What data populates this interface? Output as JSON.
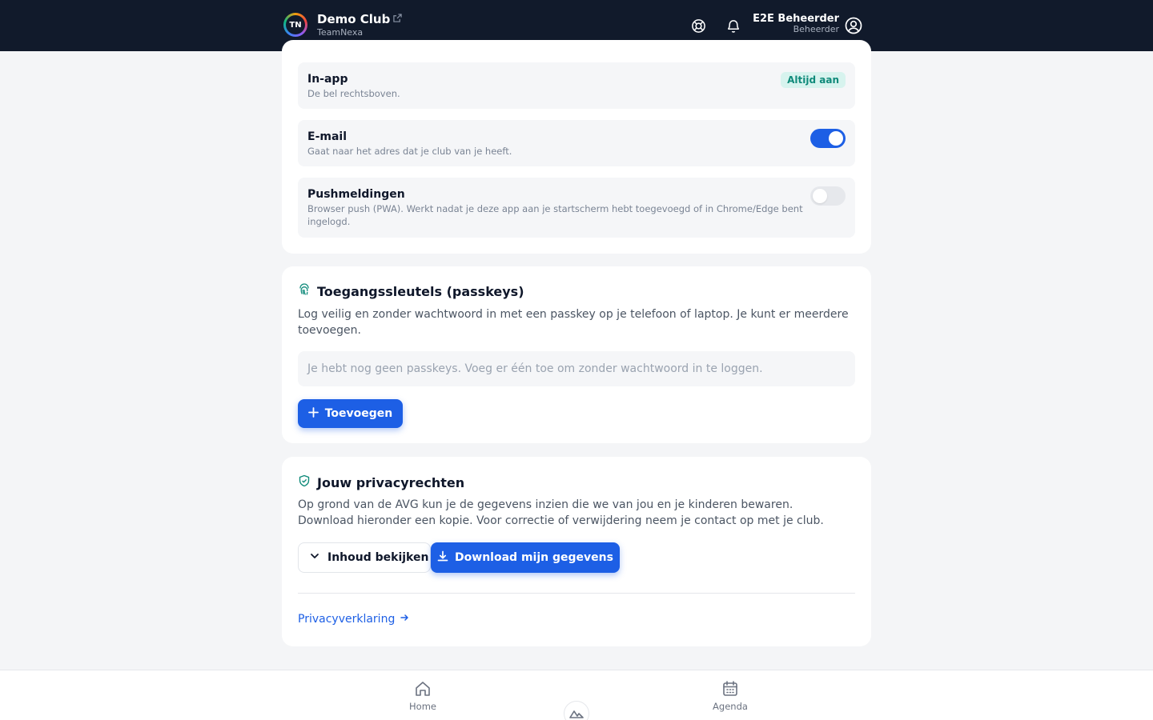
{
  "header": {
    "logo_text": "TN",
    "club_name": "Demo Club",
    "club_subtitle": "TeamNexa",
    "user_name": "E2E Beheerder",
    "user_role": "Beheerder"
  },
  "notifications": {
    "rows": [
      {
        "title": "In-app",
        "description": "De bel rechtsboven.",
        "badge": "Altijd aan"
      },
      {
        "title": "E-mail",
        "description": "Gaat naar het adres dat je club van je heeft.",
        "enabled": true
      },
      {
        "title": "Pushmeldingen",
        "description": "Browser push (PWA). Werkt nadat je deze app aan je startscherm hebt toegevoegd of in Chrome/Edge bent ingelogd.",
        "enabled": false
      }
    ]
  },
  "passkeys": {
    "title": "Toegangssleutels (passkeys)",
    "description": "Log veilig en zonder wachtwoord in met een passkey op je telefoon of laptop. Je kunt er meerdere toevoegen.",
    "empty_text": "Je hebt nog geen passkeys. Voeg er één toe om zonder wachtwoord in te loggen.",
    "add_label": "Toevoegen"
  },
  "privacy": {
    "title": "Jouw privacyrechten",
    "description": "Op grond van de AVG kun je de gegevens inzien die we van jou en je kinderen bewaren. Download hieronder een kopie. Voor correctie of verwijdering neem je contact op met je club.",
    "view_label": "Inhoud bekijken",
    "download_label": "Download mijn gegevens",
    "statement_link": "Privacyverklaring"
  },
  "bottom_nav": {
    "home": "Home",
    "agenda": "Agenda"
  },
  "colors": {
    "header_bg": "#111a2b",
    "accent": "#1d5fe5",
    "badge_bg": "#d7f3ee",
    "badge_text": "#0f8a7a",
    "teal_icon": "#0f8a7a"
  }
}
